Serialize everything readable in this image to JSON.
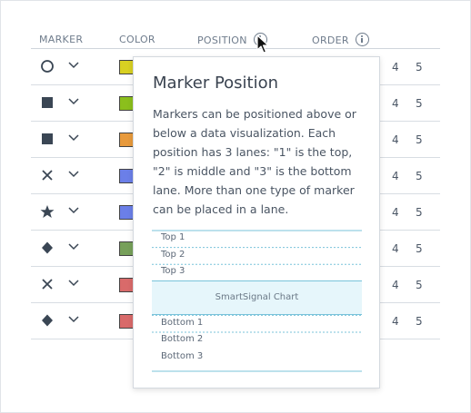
{
  "headers": {
    "marker": "MARKER",
    "color": "COLOR",
    "position": "POSITION",
    "order": "ORDER"
  },
  "rows": [
    {
      "marker_icon": "circle-outline-icon",
      "color": "#d8d022",
      "order": [
        "4",
        "5"
      ]
    },
    {
      "marker_icon": "square-icon",
      "color": "#8bbf1c",
      "order": [
        "4",
        "5"
      ]
    },
    {
      "marker_icon": "square-icon",
      "color": "#e89a3c",
      "order": [
        "4",
        "5"
      ]
    },
    {
      "marker_icon": "x-icon",
      "color": "#6b7fe8",
      "order": [
        "4",
        "5"
      ]
    },
    {
      "marker_icon": "star-icon",
      "color": "#6b7fe8",
      "order": [
        "4",
        "5"
      ]
    },
    {
      "marker_icon": "diamond-icon",
      "color": "#77a05a",
      "order": [
        "4",
        "5"
      ]
    },
    {
      "marker_icon": "x-icon",
      "color": "#d96a6a",
      "order": [
        "4",
        "5"
      ]
    },
    {
      "marker_icon": "diamond-icon",
      "color": "#d96a6a",
      "order": [
        "4",
        "5"
      ]
    }
  ],
  "tooltip": {
    "title": "Marker Position",
    "body": "Markers can be positioned above or below a data visualization. Each position has 3 lanes: \"1\" is the top, \"2\" is middle and \"3\" is the bottom lane. More than one type of marker can be placed in a lane.",
    "lanes_top": [
      "Top 1",
      "Top 2",
      "Top 3"
    ],
    "chart_label": "SmartSignal Chart",
    "lanes_bottom": [
      "Bottom 1",
      "Bottom 2",
      "Bottom 3"
    ]
  },
  "colors": {
    "lane_line": "#79c3da",
    "chart_fill": "#e6f6fb",
    "marker_fill": "#3a4654"
  }
}
